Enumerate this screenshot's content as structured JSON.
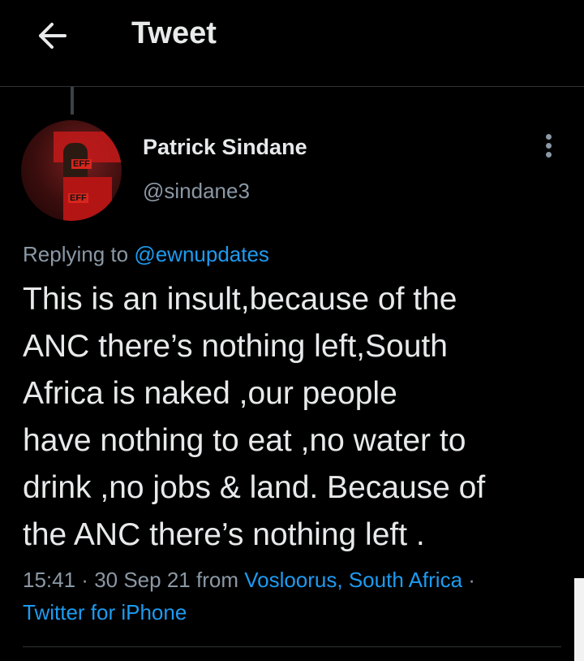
{
  "header": {
    "title": "Tweet",
    "back_icon": "arrow-left-icon"
  },
  "author": {
    "name": "Patrick Sindane",
    "handle": "@sindane3",
    "avatar_labels": [
      "EFF",
      "EFF"
    ]
  },
  "reply": {
    "prefix": "Replying to ",
    "mention": "@ewnupdates"
  },
  "tweet": {
    "text": "This is an insult,because of the\nANC there’s nothing left,South\nAfrica is naked ,our people\nhave nothing to eat ,no water to\ndrink ,no jobs & land. Because of\nthe ANC there’s nothing left ."
  },
  "meta": {
    "time": "15:41",
    "sep1": " · ",
    "date": "30 Sep 21",
    "from_label": " from ",
    "location": "Vosloorus, South Africa",
    "sep2": " ·",
    "source": "Twitter for iPhone"
  },
  "colors": {
    "accent": "#1d9bf0",
    "background": "#000000",
    "muted": "#8b98a5",
    "text": "#e7e9ea"
  }
}
